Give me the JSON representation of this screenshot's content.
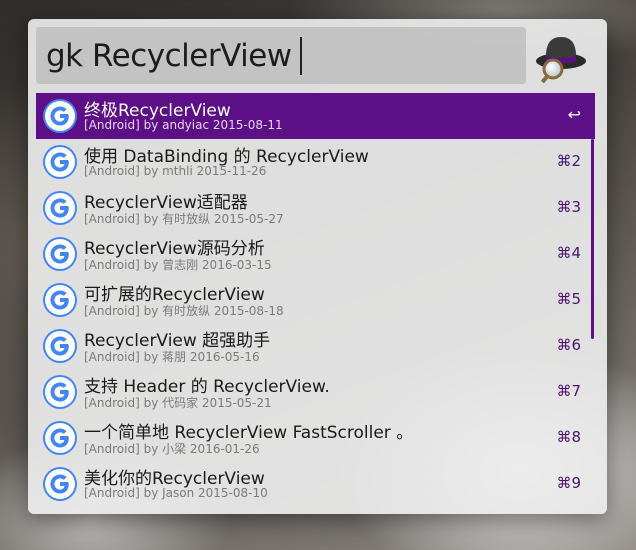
{
  "search": {
    "query": "gk RecyclerView"
  },
  "results": [
    {
      "title": "终极RecyclerView",
      "subtitle": "[Android]    by andyiac    2015-08-11",
      "shortcut": "↩",
      "selected": true
    },
    {
      "title": "使用 DataBinding 的 RecyclerView",
      "subtitle": "[Android]    by mthli    2015-11-26",
      "shortcut": "⌘2"
    },
    {
      "title": "RecyclerView适配器",
      "subtitle": "[Android]    by 有时放纵    2015-05-27",
      "shortcut": "⌘3"
    },
    {
      "title": "RecyclerView源码分析",
      "subtitle": "[Android]    by 曾志刚    2016-03-15",
      "shortcut": "⌘4"
    },
    {
      "title": "可扩展的RecyclerView",
      "subtitle": "[Android]    by 有时放纵    2015-08-18",
      "shortcut": "⌘5"
    },
    {
      "title": "RecyclerView 超强助手",
      "subtitle": "[Android]    by 蒋朋    2016-05-16",
      "shortcut": "⌘6"
    },
    {
      "title": "支持 Header 的 RecyclerView.",
      "subtitle": "[Android]    by 代码家    2015-05-21",
      "shortcut": "⌘7"
    },
    {
      "title": "一个简单地 RecyclerView FastScroller 。",
      "subtitle": "[Android]    by 小梁    2016-01-26",
      "shortcut": "⌘8"
    },
    {
      "title": "美化你的RecyclerView",
      "subtitle": "[Android]    by Jason    2015-08-10",
      "shortcut": "⌘9"
    }
  ],
  "icons": {
    "result_icon": "google-g-icon",
    "app_icon": "alfred-hat-icon"
  },
  "colors": {
    "selection": "#5c0f86",
    "shortcut": "#4a1470",
    "google_blue": "#4285f4"
  }
}
